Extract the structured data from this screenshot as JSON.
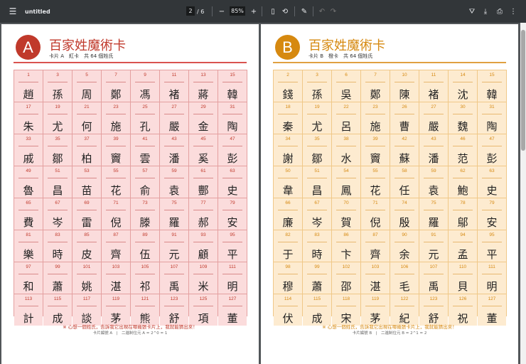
{
  "toolbar": {
    "title": "untitled",
    "page_current": "2",
    "page_total": "6",
    "zoom": "85%"
  },
  "cards": [
    {
      "letter": "A",
      "color": "#c0392b",
      "title": "百家姓魔術卡",
      "subtitle": "卡片 A　紅卡　共 64 個姓氏",
      "footer_note": "※ 心想一個姓氏，告訴我它出現在哪幾張卡片上，我就能猜出來！",
      "footer_info": "卡片編號 A　|　二進制位元 A = 2^0 = 1",
      "cells": [
        [
          "1",
          "趙"
        ],
        [
          "3",
          "孫"
        ],
        [
          "5",
          "周"
        ],
        [
          "7",
          "鄭"
        ],
        [
          "9",
          "馮"
        ],
        [
          "11",
          "褚"
        ],
        [
          "13",
          "蔣"
        ],
        [
          "15",
          "韓"
        ],
        [
          "17",
          "朱"
        ],
        [
          "19",
          "尤"
        ],
        [
          "21",
          "何"
        ],
        [
          "23",
          "施"
        ],
        [
          "25",
          "孔"
        ],
        [
          "27",
          "嚴"
        ],
        [
          "29",
          "金"
        ],
        [
          "31",
          "陶"
        ],
        [
          "33",
          "戚"
        ],
        [
          "35",
          "鄒"
        ],
        [
          "37",
          "柏"
        ],
        [
          "39",
          "竇"
        ],
        [
          "41",
          "雲"
        ],
        [
          "43",
          "潘"
        ],
        [
          "45",
          "奚"
        ],
        [
          "47",
          "彭"
        ],
        [
          "49",
          "魯"
        ],
        [
          "51",
          "昌"
        ],
        [
          "53",
          "苗"
        ],
        [
          "55",
          "花"
        ],
        [
          "57",
          "俞"
        ],
        [
          "59",
          "袁"
        ],
        [
          "61",
          "酆"
        ],
        [
          "63",
          "史"
        ],
        [
          "65",
          "費"
        ],
        [
          "67",
          "岑"
        ],
        [
          "69",
          "雷"
        ],
        [
          "71",
          "倪"
        ],
        [
          "73",
          "滕"
        ],
        [
          "75",
          "羅"
        ],
        [
          "77",
          "郝"
        ],
        [
          "79",
          "安"
        ],
        [
          "81",
          "樂"
        ],
        [
          "83",
          "時"
        ],
        [
          "85",
          "皮"
        ],
        [
          "87",
          "齊"
        ],
        [
          "89",
          "伍"
        ],
        [
          "91",
          "元"
        ],
        [
          "93",
          "顧"
        ],
        [
          "95",
          "平"
        ],
        [
          "97",
          "和"
        ],
        [
          "99",
          "蕭"
        ],
        [
          "101",
          "姚"
        ],
        [
          "103",
          "湛"
        ],
        [
          "105",
          "祁"
        ],
        [
          "107",
          "禹"
        ],
        [
          "109",
          "米"
        ],
        [
          "111",
          "明"
        ],
        [
          "113",
          "計"
        ],
        [
          "115",
          "成"
        ],
        [
          "117",
          "談"
        ],
        [
          "119",
          "茅"
        ],
        [
          "121",
          "熊"
        ],
        [
          "123",
          "舒"
        ],
        [
          "125",
          "項"
        ],
        [
          "127",
          "董"
        ]
      ]
    },
    {
      "letter": "B",
      "color": "#d68910",
      "title": "百家姓魔術卡",
      "subtitle": "卡片 B　橙卡　共 64 個姓氏",
      "footer_note": "※ 心想一個姓氏，告訴我它出現在哪幾張卡片上，我就能猜出來！",
      "footer_info": "卡片編號 B　|　二進制位元 B = 2^1 = 2",
      "cells": [
        [
          "2",
          "錢"
        ],
        [
          "3",
          "孫"
        ],
        [
          "6",
          "吳"
        ],
        [
          "7",
          "鄭"
        ],
        [
          "10",
          "陳"
        ],
        [
          "11",
          "褚"
        ],
        [
          "14",
          "沈"
        ],
        [
          "15",
          "韓"
        ],
        [
          "18",
          "秦"
        ],
        [
          "19",
          "尤"
        ],
        [
          "22",
          "呂"
        ],
        [
          "23",
          "施"
        ],
        [
          "26",
          "曹"
        ],
        [
          "27",
          "嚴"
        ],
        [
          "30",
          "魏"
        ],
        [
          "31",
          "陶"
        ],
        [
          "34",
          "謝"
        ],
        [
          "35",
          "鄒"
        ],
        [
          "38",
          "水"
        ],
        [
          "39",
          "竇"
        ],
        [
          "42",
          "蘇"
        ],
        [
          "43",
          "潘"
        ],
        [
          "46",
          "范"
        ],
        [
          "47",
          "彭"
        ],
        [
          "50",
          "韋"
        ],
        [
          "51",
          "昌"
        ],
        [
          "54",
          "鳳"
        ],
        [
          "55",
          "花"
        ],
        [
          "58",
          "任"
        ],
        [
          "59",
          "袁"
        ],
        [
          "62",
          "鮑"
        ],
        [
          "63",
          "史"
        ],
        [
          "66",
          "廉"
        ],
        [
          "67",
          "岑"
        ],
        [
          "70",
          "賀"
        ],
        [
          "71",
          "倪"
        ],
        [
          "74",
          "殷"
        ],
        [
          "75",
          "羅"
        ],
        [
          "78",
          "鄔"
        ],
        [
          "79",
          "安"
        ],
        [
          "82",
          "于"
        ],
        [
          "83",
          "時"
        ],
        [
          "86",
          "卞"
        ],
        [
          "87",
          "齊"
        ],
        [
          "90",
          "余"
        ],
        [
          "91",
          "元"
        ],
        [
          "94",
          "孟"
        ],
        [
          "95",
          "平"
        ],
        [
          "98",
          "穆"
        ],
        [
          "99",
          "蕭"
        ],
        [
          "102",
          "邵"
        ],
        [
          "103",
          "湛"
        ],
        [
          "106",
          "毛"
        ],
        [
          "107",
          "禹"
        ],
        [
          "110",
          "貝"
        ],
        [
          "111",
          "明"
        ],
        [
          "114",
          "伏"
        ],
        [
          "115",
          "成"
        ],
        [
          "118",
          "宋"
        ],
        [
          "119",
          "茅"
        ],
        [
          "122",
          "紀"
        ],
        [
          "123",
          "舒"
        ],
        [
          "126",
          "祝"
        ],
        [
          "127",
          "董"
        ]
      ]
    }
  ]
}
